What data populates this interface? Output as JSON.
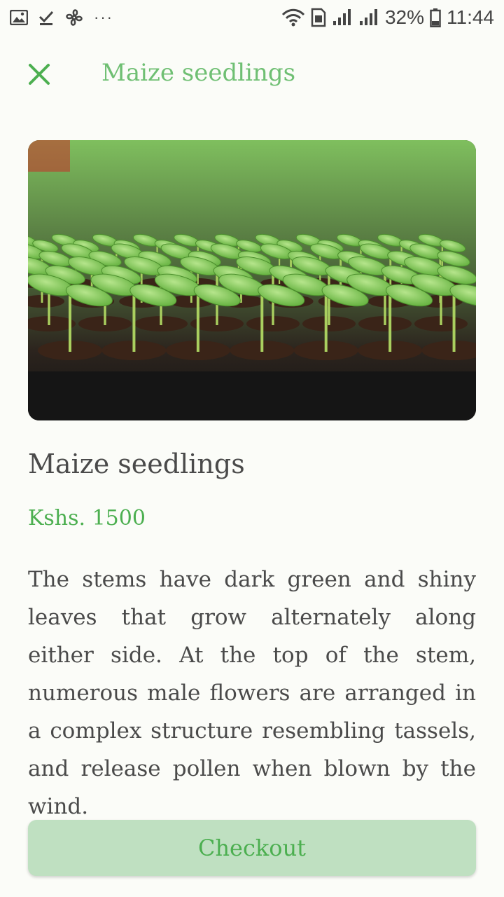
{
  "status_bar": {
    "icons_left": [
      "gallery-icon",
      "download-done-icon",
      "fan-icon"
    ],
    "more": "···",
    "icons_right": [
      "wifi-icon",
      "sim-icon",
      "signal-icon",
      "signal-icon",
      "battery-icon"
    ],
    "battery": "32%",
    "time": "11:44"
  },
  "header": {
    "close_icon": "close-icon",
    "title": "Maize seedlings"
  },
  "product": {
    "image_alt": "seedling tray photo",
    "name": "Maize seedlings",
    "price": "Kshs. 1500",
    "description": "The stems have dark green and shiny leaves that grow alternately along either side. At the top of the stem, numerous male flowers are arranged in a complex structure resembling tassels, and release pollen when blown by the wind."
  },
  "checkout": {
    "label": "Checkout"
  },
  "colors": {
    "accent": "#4caf50",
    "header_title": "#6fbf73",
    "button_bg": "#bfe0c1",
    "background": "#fbfcf8"
  }
}
